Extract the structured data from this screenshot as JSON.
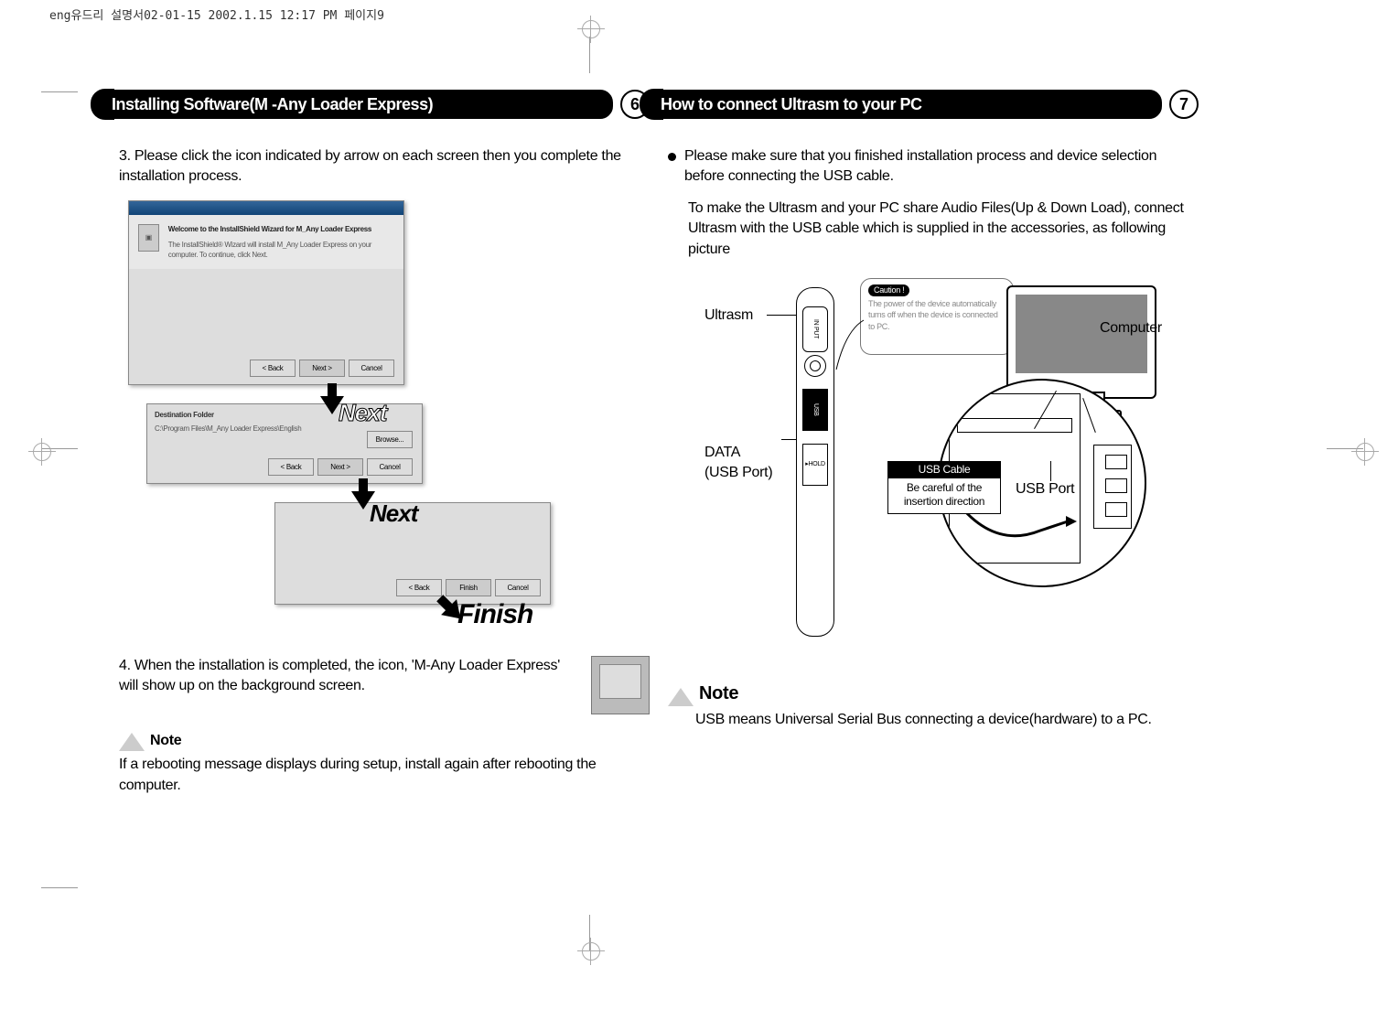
{
  "header_line": "eng유드리 설명서02-01-15  2002.1.15 12:17 PM  페이지9",
  "left": {
    "title": "Installing Software(M -Any Loader Express)",
    "page_num": "6",
    "step3": "3. Please click the icon indicated by arrow on each screen then you complete the installation process.",
    "win1_title": "Welcome to the InstallShield Wizard for M_Any Loader Express",
    "win1_body": "The InstallShield® Wizard will install M_Any Loader Express on your computer. To continue, click Next.",
    "win2_title": "Destination Folder",
    "win2_path": "C:\\Program Files\\M_Any Loader Express\\English",
    "btn_back": "< Back",
    "btn_next": "Next >",
    "btn_cancel": "Cancel",
    "btn_browse": "Browse...",
    "btn_finish": "Finish",
    "arrow_next1": "Next",
    "arrow_next2": "Next",
    "arrow_finish": "Finish",
    "step4": "4. When the installation is completed, the icon, 'M-Any Loader Express' will show up on the background screen.",
    "note_title": "Note",
    "note_body": "If a rebooting message displays during setup, install again after rebooting the computer."
  },
  "right": {
    "title": "How to connect Ultrasm to your PC",
    "page_num": "7",
    "p1": "Please make sure that you finished installation process and device selection before connecting the USB cable.",
    "p2": "To make the Ultrasm and your PC share Audio Files(Up & Down Load), connect Ultrasm with the USB cable which is supplied in the accessories, as following picture",
    "lbl_ultrasm": "Ultrasm",
    "lbl_data": "DATA\n(USB Port)",
    "lbl_computer": "Computer",
    "lbl_usbport": "USB Port",
    "caution_badge": "Caution !",
    "caution_text": "The power of the device automatically turns off when the device is connected to PC.",
    "usb_cable_hd": "USB Cable",
    "usb_cable_body": "Be careful of the insertion direction",
    "dev_sec1": "IN PUT",
    "dev_sec2": "USB",
    "dev_sec3": "HOLD",
    "note_title": "Note",
    "note_body": "USB means Universal Serial Bus connecting a device(hardware) to a PC."
  }
}
